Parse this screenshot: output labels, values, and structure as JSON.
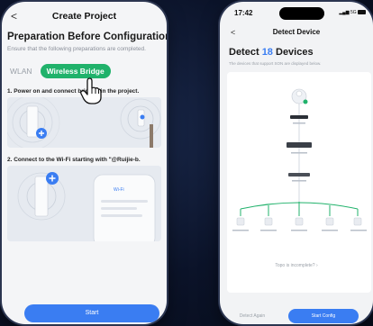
{
  "left_phone": {
    "back_glyph": "<",
    "header_title": "Create Project",
    "title": "Preparation Before Configuration",
    "subtitle": "Ensure that the following preparations are completed.",
    "tabs": [
      {
        "label": "WLAN",
        "active": false
      },
      {
        "label": "Wireless Bridge",
        "active": true
      }
    ],
    "step1": "1. Power on and connect bridges in the project.",
    "step2": "2. Connect to the Wi-Fi starting with \"@Ruijie-b.",
    "wifi_card_title": "Wi-Fi",
    "start_button": "Start"
  },
  "right_phone": {
    "time": "17:42",
    "signal": "5G",
    "back_glyph": "<",
    "header_title": "Detect Device",
    "title_prefix": "Detect",
    "device_count": "18",
    "title_suffix": "Devices",
    "subtitle": "The devices that support SON are displayed below.",
    "topology_question": "Topo is incomplete? ›",
    "detect_again_button": "Detect Again",
    "start_config_button": "Start Config"
  },
  "colors": {
    "accent_blue": "#3a7df2",
    "accent_green": "#20b26b",
    "background": "#0a1124"
  }
}
